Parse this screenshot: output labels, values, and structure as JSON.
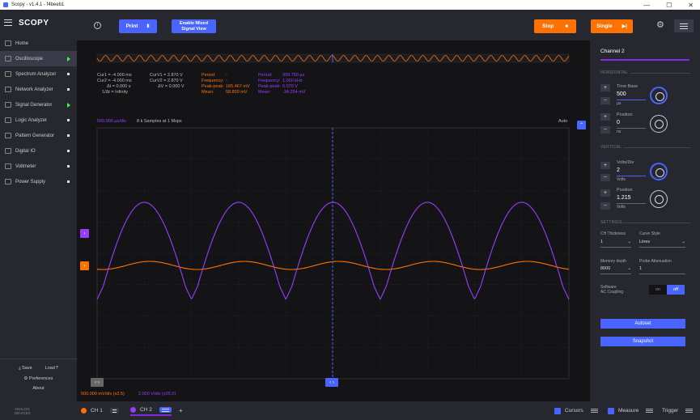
{
  "window": {
    "title": "Scopy - v1.4.1 - f4beeb1",
    "minimize": "—",
    "maximize": "☐",
    "close": "✕"
  },
  "app": {
    "logo": "scopy"
  },
  "sidebar": {
    "items": [
      {
        "label": "Home",
        "indicator": "none"
      },
      {
        "label": "Oscilloscope",
        "indicator": "arrow",
        "active": true
      },
      {
        "label": "Spectrum Analyzer",
        "indicator": "dot"
      },
      {
        "label": "Network Analyzer",
        "indicator": "dot"
      },
      {
        "label": "Signal Generator",
        "indicator": "arrow"
      },
      {
        "label": "Logic Analyzer",
        "indicator": "dot"
      },
      {
        "label": "Pattern Generator",
        "indicator": "dot"
      },
      {
        "label": "Digital IO",
        "indicator": "dot"
      },
      {
        "label": "Voltmeter",
        "indicator": "dot"
      },
      {
        "label": "Power Supply",
        "indicator": "dot"
      }
    ],
    "save": "Save",
    "load": "Load",
    "preferences": "Preferences",
    "about": "About",
    "brand": "ANALOG\nDEVICES"
  },
  "toolbar": {
    "print": "Print",
    "mixed_signal": "Enable Mixed\nSignal View",
    "stop": "Stop",
    "single": "Single"
  },
  "measurements": {
    "cursors_time": [
      "Cur1 = -4.000 ms",
      "Cur2 = -4.000 ms",
      "Δt = 0.000 s",
      "1/Δt = Infinity"
    ],
    "cursors_volt": [
      "CurV1 = 2.870 V",
      "CurV2 = 2.870 V",
      "ΔV = 0.000 V"
    ],
    "ch1": {
      "labels": [
        "Period:",
        "Frequency:",
        "Peak-peak:",
        "Mean:"
      ],
      "values": [
        "-",
        "-",
        "165.467 mV",
        "58.809 mV"
      ]
    },
    "ch2": {
      "labels": [
        "Period:",
        "Frequency:",
        "Peak-peak:",
        "Mean:"
      ],
      "values": [
        "999.750 µs",
        "1.000 kHz",
        "6.070 V",
        "-34.254 mV"
      ]
    }
  },
  "plot": {
    "timebase": "500.000 µs/div",
    "samples": "8 k Samples at 1 Msps",
    "trigger_mode": "Auto",
    "ch1_scale": "500.000 mV/div (x2.5)",
    "ch2_scale": "2.000 V/div (x25.0)"
  },
  "channel_panel": {
    "title": "Channel 2",
    "horizontal": "HORIZONTAL",
    "time_base_label": "Time Base",
    "time_base_value": "500",
    "time_base_unit": "µs",
    "position_label": "Position",
    "h_position_value": "0",
    "h_position_unit": "ns",
    "vertical": "VERTICAL",
    "volts_div_label": "Volts/Div",
    "volts_div_value": "2",
    "volts_div_unit": "Volts",
    "v_position_label": "Position",
    "v_position_value": "1.215",
    "v_position_unit": "Volts",
    "settings": "SETTINGS",
    "ch_thickness_label": "CH Thickness",
    "ch_thickness_value": "1",
    "curve_style_label": "Curve Style",
    "curve_style_value": "Lines",
    "memory_depth_label": "Memory depth",
    "memory_depth_value": "8000",
    "probe_att_label": "Probe Attenuation",
    "probe_att_value": "1",
    "ac_coupling_label": "Software\nAC Coupling",
    "toggle_on": "on",
    "toggle_off": "off",
    "autoset": "Autoset",
    "snapshot": "Snapshot"
  },
  "bottom": {
    "ch1": "CH 1",
    "ch2": "CH 2",
    "add": "+",
    "cursors": "Cursors",
    "measure": "Measure",
    "trigger": "Trigger"
  },
  "colors": {
    "ch1": "#ff7200",
    "ch2": "#9a3cff",
    "accent": "#4a64ff",
    "background": "#141416",
    "panel": "#272730"
  }
}
